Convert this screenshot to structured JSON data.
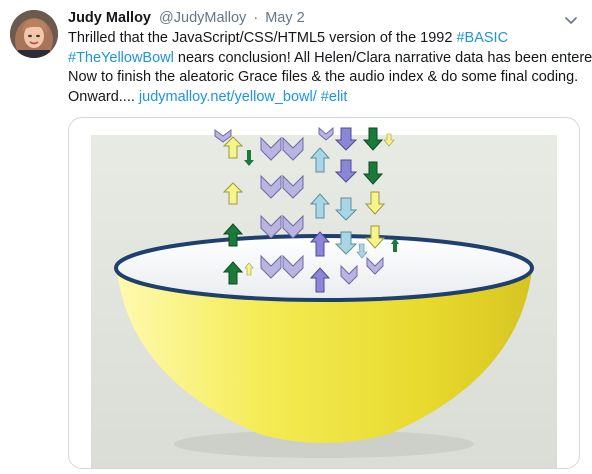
{
  "tweet": {
    "author_name": "Judy Malloy",
    "author_handle": "@JudyMalloy",
    "separator": "·",
    "date": "May 2",
    "text_line1": "Thrilled that the JavaScript/CSS/HTML5 version  of the 1992 ",
    "hashtag_basic": "#BASIC",
    "hashtag_yellowbowl": "#TheYellowBowl",
    "text_line2_rest": " nears conclusion! All Helen/Clara narrative data has  been entered.",
    "text_line3": "Now to finish the  aleatoric Grace files & the audio index & do some final coding.",
    "text_line4_start": "Onward.... ",
    "link_url": "judymalloy.net/yellow_bowl/",
    "hashtag_elit": " #elit"
  },
  "colors": {
    "link": "#1b95e0",
    "bowl_yellow": "#f1e84a",
    "bowl_rim": "#1f3f6e",
    "arrow_green": "#1a7a3a",
    "arrow_yellow": "#f7f48a",
    "arrow_lightblue": "#a9d6e6",
    "arrow_purple": "#8b87d6",
    "arrow_lavender": "#b9b4e0"
  },
  "icons": {
    "menu": "chevron-down-icon",
    "avatar": "avatar-photo"
  }
}
